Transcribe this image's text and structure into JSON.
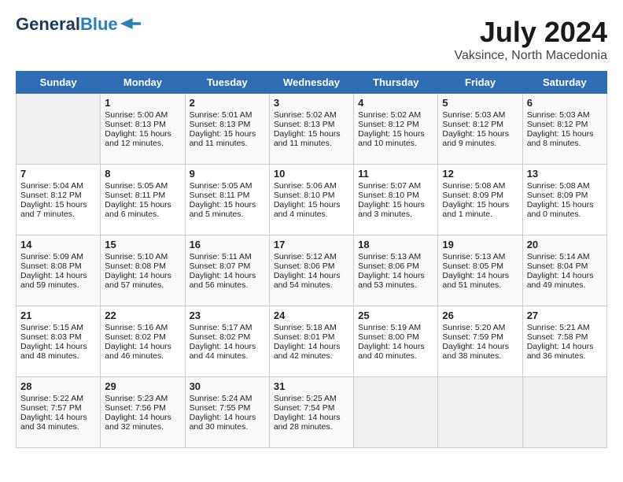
{
  "header": {
    "logo_line1": "General",
    "logo_line2": "Blue",
    "month_year": "July 2024",
    "location": "Vaksince, North Macedonia"
  },
  "weekdays": [
    "Sunday",
    "Monday",
    "Tuesday",
    "Wednesday",
    "Thursday",
    "Friday",
    "Saturday"
  ],
  "weeks": [
    [
      {
        "day": "",
        "info": ""
      },
      {
        "day": "1",
        "info": "Sunrise: 5:00 AM\nSunset: 8:13 PM\nDaylight: 15 hours\nand 12 minutes."
      },
      {
        "day": "2",
        "info": "Sunrise: 5:01 AM\nSunset: 8:13 PM\nDaylight: 15 hours\nand 11 minutes."
      },
      {
        "day": "3",
        "info": "Sunrise: 5:02 AM\nSunset: 8:13 PM\nDaylight: 15 hours\nand 11 minutes."
      },
      {
        "day": "4",
        "info": "Sunrise: 5:02 AM\nSunset: 8:12 PM\nDaylight: 15 hours\nand 10 minutes."
      },
      {
        "day": "5",
        "info": "Sunrise: 5:03 AM\nSunset: 8:12 PM\nDaylight: 15 hours\nand 9 minutes."
      },
      {
        "day": "6",
        "info": "Sunrise: 5:03 AM\nSunset: 8:12 PM\nDaylight: 15 hours\nand 8 minutes."
      }
    ],
    [
      {
        "day": "7",
        "info": "Sunrise: 5:04 AM\nSunset: 8:12 PM\nDaylight: 15 hours\nand 7 minutes."
      },
      {
        "day": "8",
        "info": "Sunrise: 5:05 AM\nSunset: 8:11 PM\nDaylight: 15 hours\nand 6 minutes."
      },
      {
        "day": "9",
        "info": "Sunrise: 5:05 AM\nSunset: 8:11 PM\nDaylight: 15 hours\nand 5 minutes."
      },
      {
        "day": "10",
        "info": "Sunrise: 5:06 AM\nSunset: 8:10 PM\nDaylight: 15 hours\nand 4 minutes."
      },
      {
        "day": "11",
        "info": "Sunrise: 5:07 AM\nSunset: 8:10 PM\nDaylight: 15 hours\nand 3 minutes."
      },
      {
        "day": "12",
        "info": "Sunrise: 5:08 AM\nSunset: 8:09 PM\nDaylight: 15 hours\nand 1 minute."
      },
      {
        "day": "13",
        "info": "Sunrise: 5:08 AM\nSunset: 8:09 PM\nDaylight: 15 hours\nand 0 minutes."
      }
    ],
    [
      {
        "day": "14",
        "info": "Sunrise: 5:09 AM\nSunset: 8:08 PM\nDaylight: 14 hours\nand 59 minutes."
      },
      {
        "day": "15",
        "info": "Sunrise: 5:10 AM\nSunset: 8:08 PM\nDaylight: 14 hours\nand 57 minutes."
      },
      {
        "day": "16",
        "info": "Sunrise: 5:11 AM\nSunset: 8:07 PM\nDaylight: 14 hours\nand 56 minutes."
      },
      {
        "day": "17",
        "info": "Sunrise: 5:12 AM\nSunset: 8:06 PM\nDaylight: 14 hours\nand 54 minutes."
      },
      {
        "day": "18",
        "info": "Sunrise: 5:13 AM\nSunset: 8:06 PM\nDaylight: 14 hours\nand 53 minutes."
      },
      {
        "day": "19",
        "info": "Sunrise: 5:13 AM\nSunset: 8:05 PM\nDaylight: 14 hours\nand 51 minutes."
      },
      {
        "day": "20",
        "info": "Sunrise: 5:14 AM\nSunset: 8:04 PM\nDaylight: 14 hours\nand 49 minutes."
      }
    ],
    [
      {
        "day": "21",
        "info": "Sunrise: 5:15 AM\nSunset: 8:03 PM\nDaylight: 14 hours\nand 48 minutes."
      },
      {
        "day": "22",
        "info": "Sunrise: 5:16 AM\nSunset: 8:02 PM\nDaylight: 14 hours\nand 46 minutes."
      },
      {
        "day": "23",
        "info": "Sunrise: 5:17 AM\nSunset: 8:02 PM\nDaylight: 14 hours\nand 44 minutes."
      },
      {
        "day": "24",
        "info": "Sunrise: 5:18 AM\nSunset: 8:01 PM\nDaylight: 14 hours\nand 42 minutes."
      },
      {
        "day": "25",
        "info": "Sunrise: 5:19 AM\nSunset: 8:00 PM\nDaylight: 14 hours\nand 40 minutes."
      },
      {
        "day": "26",
        "info": "Sunrise: 5:20 AM\nSunset: 7:59 PM\nDaylight: 14 hours\nand 38 minutes."
      },
      {
        "day": "27",
        "info": "Sunrise: 5:21 AM\nSunset: 7:58 PM\nDaylight: 14 hours\nand 36 minutes."
      }
    ],
    [
      {
        "day": "28",
        "info": "Sunrise: 5:22 AM\nSunset: 7:57 PM\nDaylight: 14 hours\nand 34 minutes."
      },
      {
        "day": "29",
        "info": "Sunrise: 5:23 AM\nSunset: 7:56 PM\nDaylight: 14 hours\nand 32 minutes."
      },
      {
        "day": "30",
        "info": "Sunrise: 5:24 AM\nSunset: 7:55 PM\nDaylight: 14 hours\nand 30 minutes."
      },
      {
        "day": "31",
        "info": "Sunrise: 5:25 AM\nSunset: 7:54 PM\nDaylight: 14 hours\nand 28 minutes."
      },
      {
        "day": "",
        "info": ""
      },
      {
        "day": "",
        "info": ""
      },
      {
        "day": "",
        "info": ""
      }
    ]
  ]
}
